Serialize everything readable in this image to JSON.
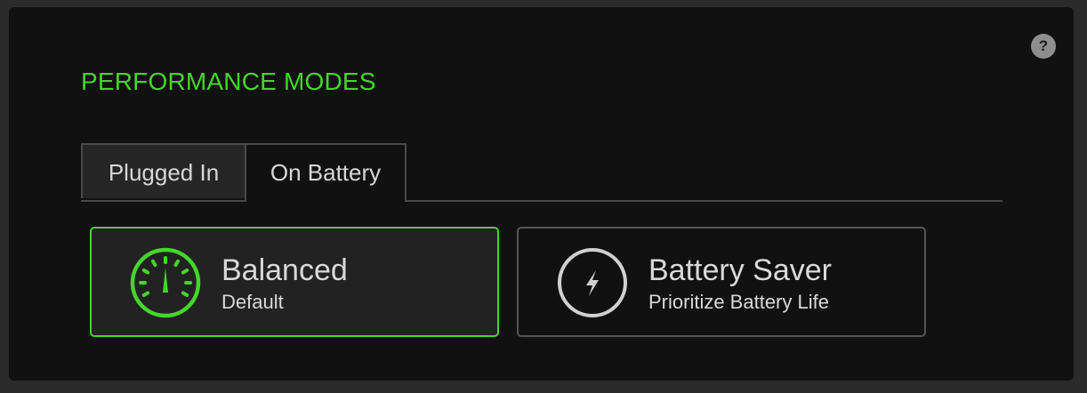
{
  "header": {
    "title": "PERFORMANCE MODES",
    "help_icon": "?"
  },
  "tabs": [
    {
      "label": "Plugged In",
      "active": false
    },
    {
      "label": "On Battery",
      "active": true
    }
  ],
  "modes": [
    {
      "name": "Balanced",
      "description": "Default",
      "icon": "speedometer-icon",
      "selected": true
    },
    {
      "name": "Battery Saver",
      "description": "Prioritize Battery Life",
      "icon": "lightning-icon",
      "selected": false
    }
  ],
  "colors": {
    "accent": "#44d62c",
    "background": "#111111",
    "text": "#d9d9d9"
  }
}
